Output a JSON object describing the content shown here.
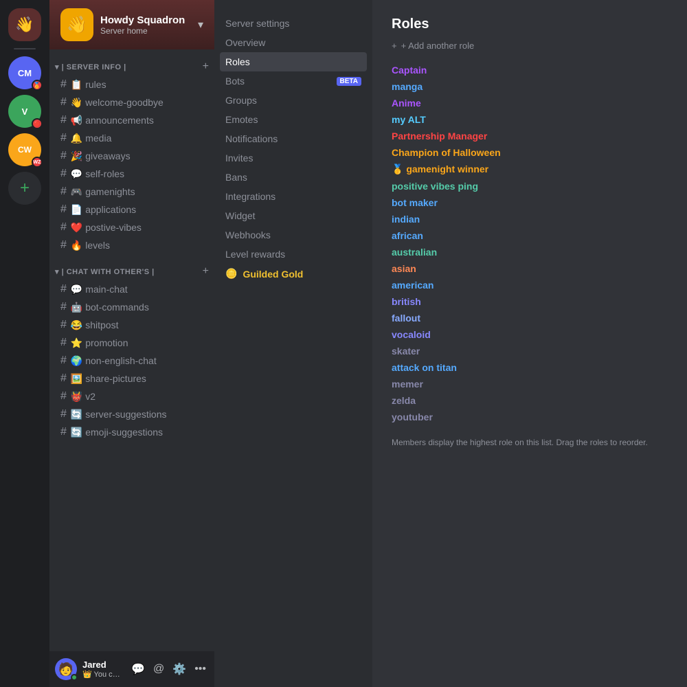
{
  "serverIcons": [
    {
      "id": "cm",
      "label": "CM",
      "bg": "#5865f2",
      "badge": "🏅",
      "badgeBg": "#ed4245"
    },
    {
      "id": "v",
      "label": "V",
      "bg": "#3ba55c",
      "badge": "🔴",
      "badgeBg": "#ed4245"
    },
    {
      "id": "cw",
      "label": "CW",
      "bg": "#faa61a",
      "badge": "WZ",
      "badgeBg": "#ed4245"
    }
  ],
  "server": {
    "name": "Howdy Squadron",
    "subtitle": "Server home",
    "logo": "👋",
    "logoBg": "#f0a500"
  },
  "categories": [
    {
      "name": "| Server Info |",
      "channels": [
        {
          "emoji": "📋",
          "name": "rules"
        },
        {
          "emoji": "👋",
          "name": "welcome-goodbye"
        },
        {
          "emoji": "📢",
          "name": "announcements"
        },
        {
          "emoji": "🔔",
          "name": "media"
        },
        {
          "emoji": "🎉",
          "name": "giveaways"
        },
        {
          "emoji": "💬",
          "name": "self-roles"
        },
        {
          "emoji": "🎮",
          "name": "gamenights"
        },
        {
          "emoji": "📄",
          "name": "applications"
        },
        {
          "emoji": "❤️",
          "name": "postive-vibes"
        },
        {
          "emoji": "🔥",
          "name": "levels"
        }
      ]
    },
    {
      "name": "| Chat With other's |",
      "channels": [
        {
          "emoji": "💬",
          "name": "main-chat"
        },
        {
          "emoji": "🤖",
          "name": "bot-commands"
        },
        {
          "emoji": "😂",
          "name": "shitpost"
        },
        {
          "emoji": "⭐",
          "name": "promotion"
        },
        {
          "emoji": "🌍",
          "name": "non-english-chat"
        },
        {
          "emoji": "🖼️",
          "name": "share-pictures"
        },
        {
          "emoji": "👹",
          "name": "v2"
        },
        {
          "emoji": "🔄",
          "name": "server-suggestions"
        },
        {
          "emoji": "🔄",
          "name": "emoji-suggestions"
        }
      ]
    }
  ],
  "user": {
    "name": "Jared",
    "status": "👑 You come again...",
    "avatar": "🧑",
    "avatarBg": "#5865f2"
  },
  "settingsNav": {
    "items": [
      {
        "label": "Server settings",
        "active": false,
        "key": "server-settings"
      },
      {
        "label": "Overview",
        "active": false,
        "key": "overview"
      },
      {
        "label": "Roles",
        "active": true,
        "key": "roles"
      },
      {
        "label": "Bots",
        "active": false,
        "key": "bots",
        "badge": "BETA"
      },
      {
        "label": "Groups",
        "active": false,
        "key": "groups"
      },
      {
        "label": "Emotes",
        "active": false,
        "key": "emotes"
      },
      {
        "label": "Notifications",
        "active": false,
        "key": "notifications"
      },
      {
        "label": "Invites",
        "active": false,
        "key": "invites"
      },
      {
        "label": "Bans",
        "active": false,
        "key": "bans"
      },
      {
        "label": "Integrations",
        "active": false,
        "key": "integrations"
      },
      {
        "label": "Widget",
        "active": false,
        "key": "widget"
      },
      {
        "label": "Webhooks",
        "active": false,
        "key": "webhooks"
      },
      {
        "label": "Level rewards",
        "active": false,
        "key": "level-rewards"
      }
    ],
    "guildedGold": {
      "emoji": "🪙",
      "label": "Guilded Gold"
    }
  },
  "roles": {
    "title": "Roles",
    "addLabel": "+ Add another role",
    "items": [
      {
        "name": "Captain",
        "color": "#aa55ff"
      },
      {
        "name": "manga",
        "color": "#55aaff"
      },
      {
        "name": "Anime",
        "color": "#aa55ff"
      },
      {
        "name": "my ALT",
        "color": "#55ccff"
      },
      {
        "name": "Partnership Manager",
        "color": "#ff4444"
      },
      {
        "name": "Champion of Halloween",
        "color": "#faa61a"
      },
      {
        "name": "🥇 gamenight winner",
        "color": "#faa61a"
      },
      {
        "name": "positive vibes ping",
        "color": "#55ccaa"
      },
      {
        "name": "bot maker",
        "color": "#55aaff"
      },
      {
        "name": "indian",
        "color": "#55aaff"
      },
      {
        "name": "african",
        "color": "#55aaff"
      },
      {
        "name": "australian",
        "color": "#55ccaa"
      },
      {
        "name": "asian",
        "color": "#ff8855"
      },
      {
        "name": "american",
        "color": "#55aaff"
      },
      {
        "name": "british",
        "color": "#8888ff"
      },
      {
        "name": "fallout",
        "color": "#88aaff"
      },
      {
        "name": "vocaloid",
        "color": "#8888ff"
      },
      {
        "name": "skater",
        "color": "#8888aa"
      },
      {
        "name": "attack on titan",
        "color": "#55aaff"
      },
      {
        "name": "memer",
        "color": "#8888aa"
      },
      {
        "name": "zelda",
        "color": "#8888aa"
      },
      {
        "name": "youtuber",
        "color": "#8888aa"
      }
    ],
    "footer": "Members display the highest role on this list. Drag the roles to reorder."
  }
}
